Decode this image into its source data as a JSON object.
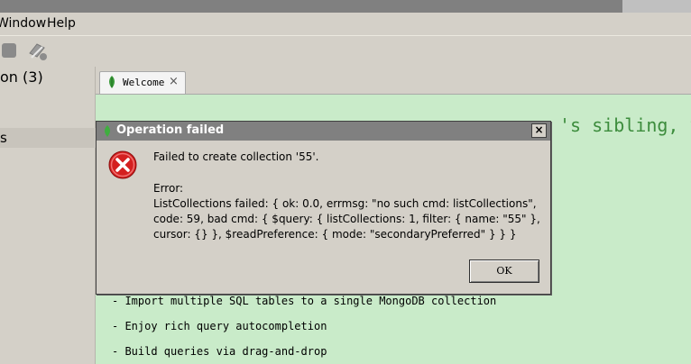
{
  "menubar": {
    "items": [
      "Window",
      "Help"
    ]
  },
  "sidebar": {
    "items": [
      "on (3)",
      "s"
    ]
  },
  "tabs": [
    {
      "label": "Welcome"
    }
  ],
  "content": {
    "headline": "'s sibling, S",
    "features": [
      "- Import multiple SQL tables to a single MongoDB collection",
      "- Enjoy rich query autocompletion",
      "- Build queries via drag-and-drop"
    ]
  },
  "dialog": {
    "title": "Operation failed",
    "message": "Failed to create collection '55'.",
    "error_label": "Error:",
    "error_lines": [
      "ListCollections failed: { ok: 0.0, errmsg: \"no such cmd: listCollections\",",
      "code: 59, bad cmd: { $query: { listCollections: 1, filter: { name: \"55\" },",
      "cursor: {} }, $readPreference: { mode: \"secondaryPreferred\" } } }"
    ],
    "ok_label": "OK",
    "close_glyph": "×"
  },
  "icons": {
    "tab_icon": "leaf-icon",
    "error_icon": "error-icon",
    "refresh_icon": "refresh-icon"
  },
  "colors": {
    "content_bg": "#c9ebc9",
    "headline": "#3c8c3c",
    "dialog_titlebar": "#808080",
    "error_red": "#d42020"
  }
}
